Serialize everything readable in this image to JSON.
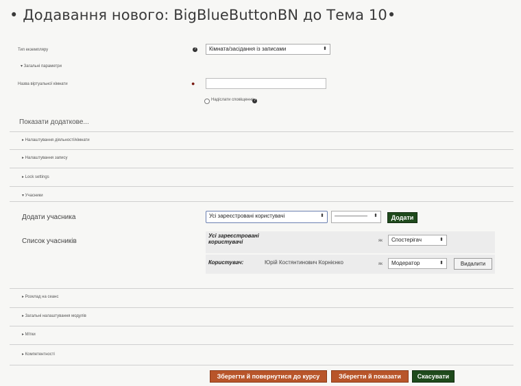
{
  "page": {
    "title": "• Додавання нового: BigBlueButtonBN до Тема 10•"
  },
  "form": {
    "instance_type_label": "Тип екземпляру",
    "instance_type_value": "Кімната/засідання із записами",
    "general_section": "▾ Загальні параметри",
    "virtual_room_label": "Назва віртуальної кімнати",
    "welcome_checkbox_label": "Надіслати сповіщення",
    "show_more": "Показати додаткове...",
    "sections_top": [
      "▸ Налаштування діяльності/кімнати",
      "▸ Налаштування запису",
      "▸ Lock settings"
    ],
    "participants_section": "▾ Учасники",
    "add_participant_label": "Додати учасника",
    "add_participant_select": "Усі зареєстровані користувачі",
    "add_participant_select2": "——————",
    "add_button": "Додати",
    "participant_list_label": "Список учасників",
    "row1_name": "Усі зареєстровані користувачі",
    "row1_as": "як",
    "row1_role": "Спостерігач",
    "row2_prefix": "Користувач:",
    "row2_name": "Юрій Костянтинович Корнієнко",
    "row2_as": "як",
    "row2_role": "Модератор",
    "remove_button": "Видалити",
    "sections_bottom": [
      "▸ Розклад на сеанс",
      "▸ Загальні налаштування модулів",
      "▸ Мітки",
      "▸ Компетентності"
    ]
  },
  "actions": {
    "save_return": "Зберегти й повернутися до курсу",
    "save_display": "Зберегти й показати",
    "cancel": "Скасувати"
  },
  "colors": {
    "green": "#1f4a1c",
    "orange": "#b8552a"
  }
}
